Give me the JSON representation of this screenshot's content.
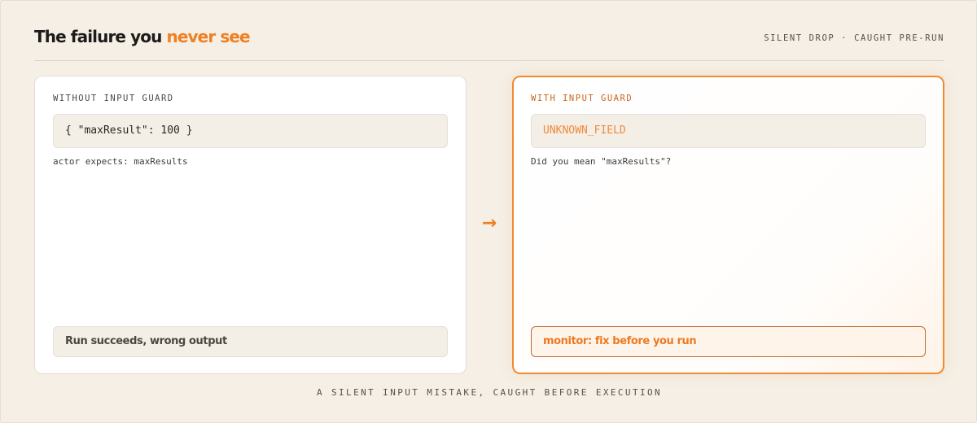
{
  "header": {
    "title_main": "The failure you ",
    "title_accent": "never see",
    "meta": "SILENT DROP · CAUGHT PRE-RUN"
  },
  "left_panel": {
    "label": "WITHOUT INPUT GUARD",
    "code": "{ \"maxResult\": 100 }",
    "note": "actor expects: maxResults",
    "result": "Run succeeds, wrong output"
  },
  "arrow": "→",
  "right_panel": {
    "label": "WITH INPUT GUARD",
    "code": "UNKNOWN_FIELD",
    "note": "Did you mean \"maxResults\"?",
    "result": "monitor: fix before you run"
  },
  "footer": "A SILENT INPUT MISTAKE, CAUGHT BEFORE EXECUTION",
  "colors": {
    "background": "#f5efe5",
    "accent": "#f07f22",
    "panel": "#ffffff",
    "code_box": "#f4efe6",
    "text": "#1c1b19"
  }
}
